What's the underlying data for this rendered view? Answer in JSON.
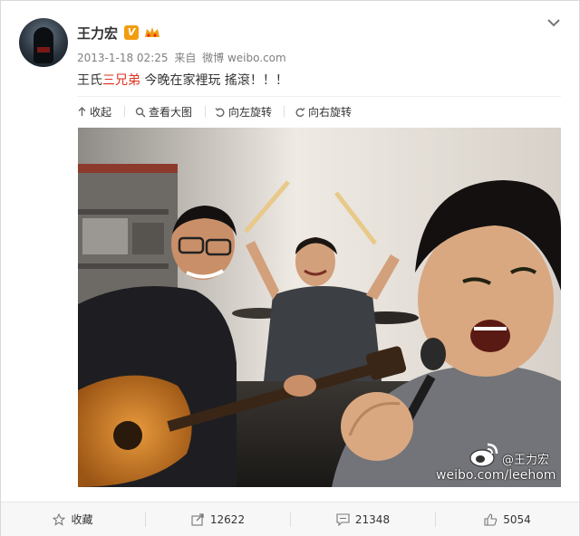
{
  "post": {
    "author": "王力宏",
    "verified_mark": "V",
    "timestamp": "2013-1-18 02:25",
    "source_prefix": "来自",
    "source": "微博 weibo.com",
    "text_before": "王氏",
    "text_highlight": "三兄弟",
    "text_after": " 今晚在家裡玩 搖滾！！！"
  },
  "toolbar": {
    "collapse": "收起",
    "view_large": "查看大图",
    "rotate_left": "向左旋转",
    "rotate_right": "向右旋转"
  },
  "watermark": {
    "handle": "@王力宏",
    "url": "weibo.com/leehom"
  },
  "actions": {
    "favorite": "收藏",
    "reposts": "12622",
    "comments": "21348",
    "likes": "5054"
  },
  "colors": {
    "highlight": "#e0301e",
    "verified_badge": "#f29c10",
    "accent_icon": "#f29c10"
  }
}
